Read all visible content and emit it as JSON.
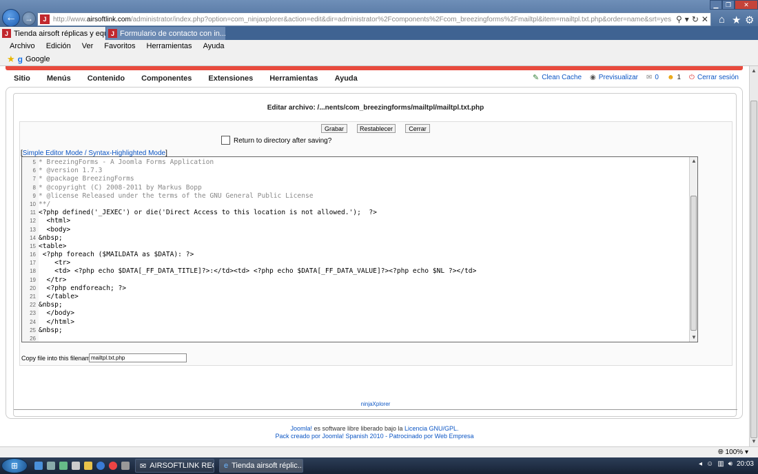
{
  "browser": {
    "url_prefix": "http://www.",
    "url_domain": "airsoftlink.com",
    "url_path": "/administrator/index.php?option=com_ninjaxplorer&action=edit&dir=administrator%2Fcomponents%2Fcom_breezingforms%2Fmailtpl&item=mailtpl.txt.php&order=name&srt=yes",
    "tabs": [
      {
        "label": "Tienda airsoft réplicas y equ..."
      },
      {
        "label": "Formulario de contacto con in..."
      }
    ],
    "menu": [
      "Archivo",
      "Edición",
      "Ver",
      "Favoritos",
      "Herramientas",
      "Ayuda"
    ],
    "favorites": {
      "google": "Google"
    },
    "zoom": "100%"
  },
  "admin_menu": {
    "items": [
      "Sitio",
      "Menús",
      "Contenido",
      "Componentes",
      "Extensiones",
      "Herramientas",
      "Ayuda"
    ],
    "clean_cache": "Clean Cache",
    "preview": "Previsualizar",
    "messages_count": "0",
    "users_count": "1",
    "logout": "Cerrar sesión"
  },
  "editor_page": {
    "title": "Editar archivo: /...nents/com_breezingforms/mailtpl/mailtpl.txt.php",
    "save": "Grabar",
    "reset": "Restablecer",
    "close": "Cerrar",
    "return_label": "Return to directory after saving?",
    "mode_link": "Simple Editor Mode / Syntax-Highlighted Mode",
    "copy_label": "Copy file into this filename",
    "copy_value": "mailtpl.txt.php",
    "ninja": "ninjaXplorer"
  },
  "code_lines": [
    {
      "n": "5",
      "t": "* BreezingForms - A Joomla Forms Application"
    },
    {
      "n": "6",
      "t": "* @version 1.7.3"
    },
    {
      "n": "7",
      "t": "* @package BreezingForms"
    },
    {
      "n": "8",
      "t": "* @copyright (C) 2008-2011 by Markus Bopp"
    },
    {
      "n": "9",
      "t": "* @license Released under the terms of the GNU General Public License"
    },
    {
      "n": "10",
      "t": "**/"
    },
    {
      "n": "11",
      "t": "<?php defined('_JEXEC') or die('Direct Access to this location is not allowed.');  ?>"
    },
    {
      "n": "12",
      "t": "  <html>"
    },
    {
      "n": "13",
      "t": "  <body>"
    },
    {
      "n": "14",
      "t": "&nbsp;"
    },
    {
      "n": "15",
      "t": "<table>"
    },
    {
      "n": "16",
      "t": " <?php foreach ($MAILDATA as $DATA): ?>"
    },
    {
      "n": "17",
      "t": "    <tr>"
    },
    {
      "n": "18",
      "t": "    <td> <?php echo $DATA[_FF_DATA_TITLE]?>:</td><td> <?php echo $DATA[_FF_DATA_VALUE]?><?php echo $NL ?></td>"
    },
    {
      "n": "19",
      "t": "  </tr>"
    },
    {
      "n": "20",
      "t": "  <?php endforeach; ?>"
    },
    {
      "n": "21",
      "t": "  </table>"
    },
    {
      "n": "22",
      "t": "&nbsp;"
    },
    {
      "n": "23",
      "t": "  </body>"
    },
    {
      "n": "24",
      "t": "  </html>"
    },
    {
      "n": "25",
      "t": "&nbsp;"
    },
    {
      "n": "26",
      "t": ""
    }
  ],
  "footer": {
    "joomla": "Joomla!",
    "line1_rest": " es software libre liberado bajo la ",
    "license": "Licencia GNU/GPL.",
    "line2": "Pack creado por Joomla! Spanish 2010 - Patrocinado por Web Empresa"
  },
  "taskbar": {
    "task1": "AIRSOFTLINK RECIB...",
    "task2": "Tienda airsoft réplic...",
    "time": "20:03"
  }
}
